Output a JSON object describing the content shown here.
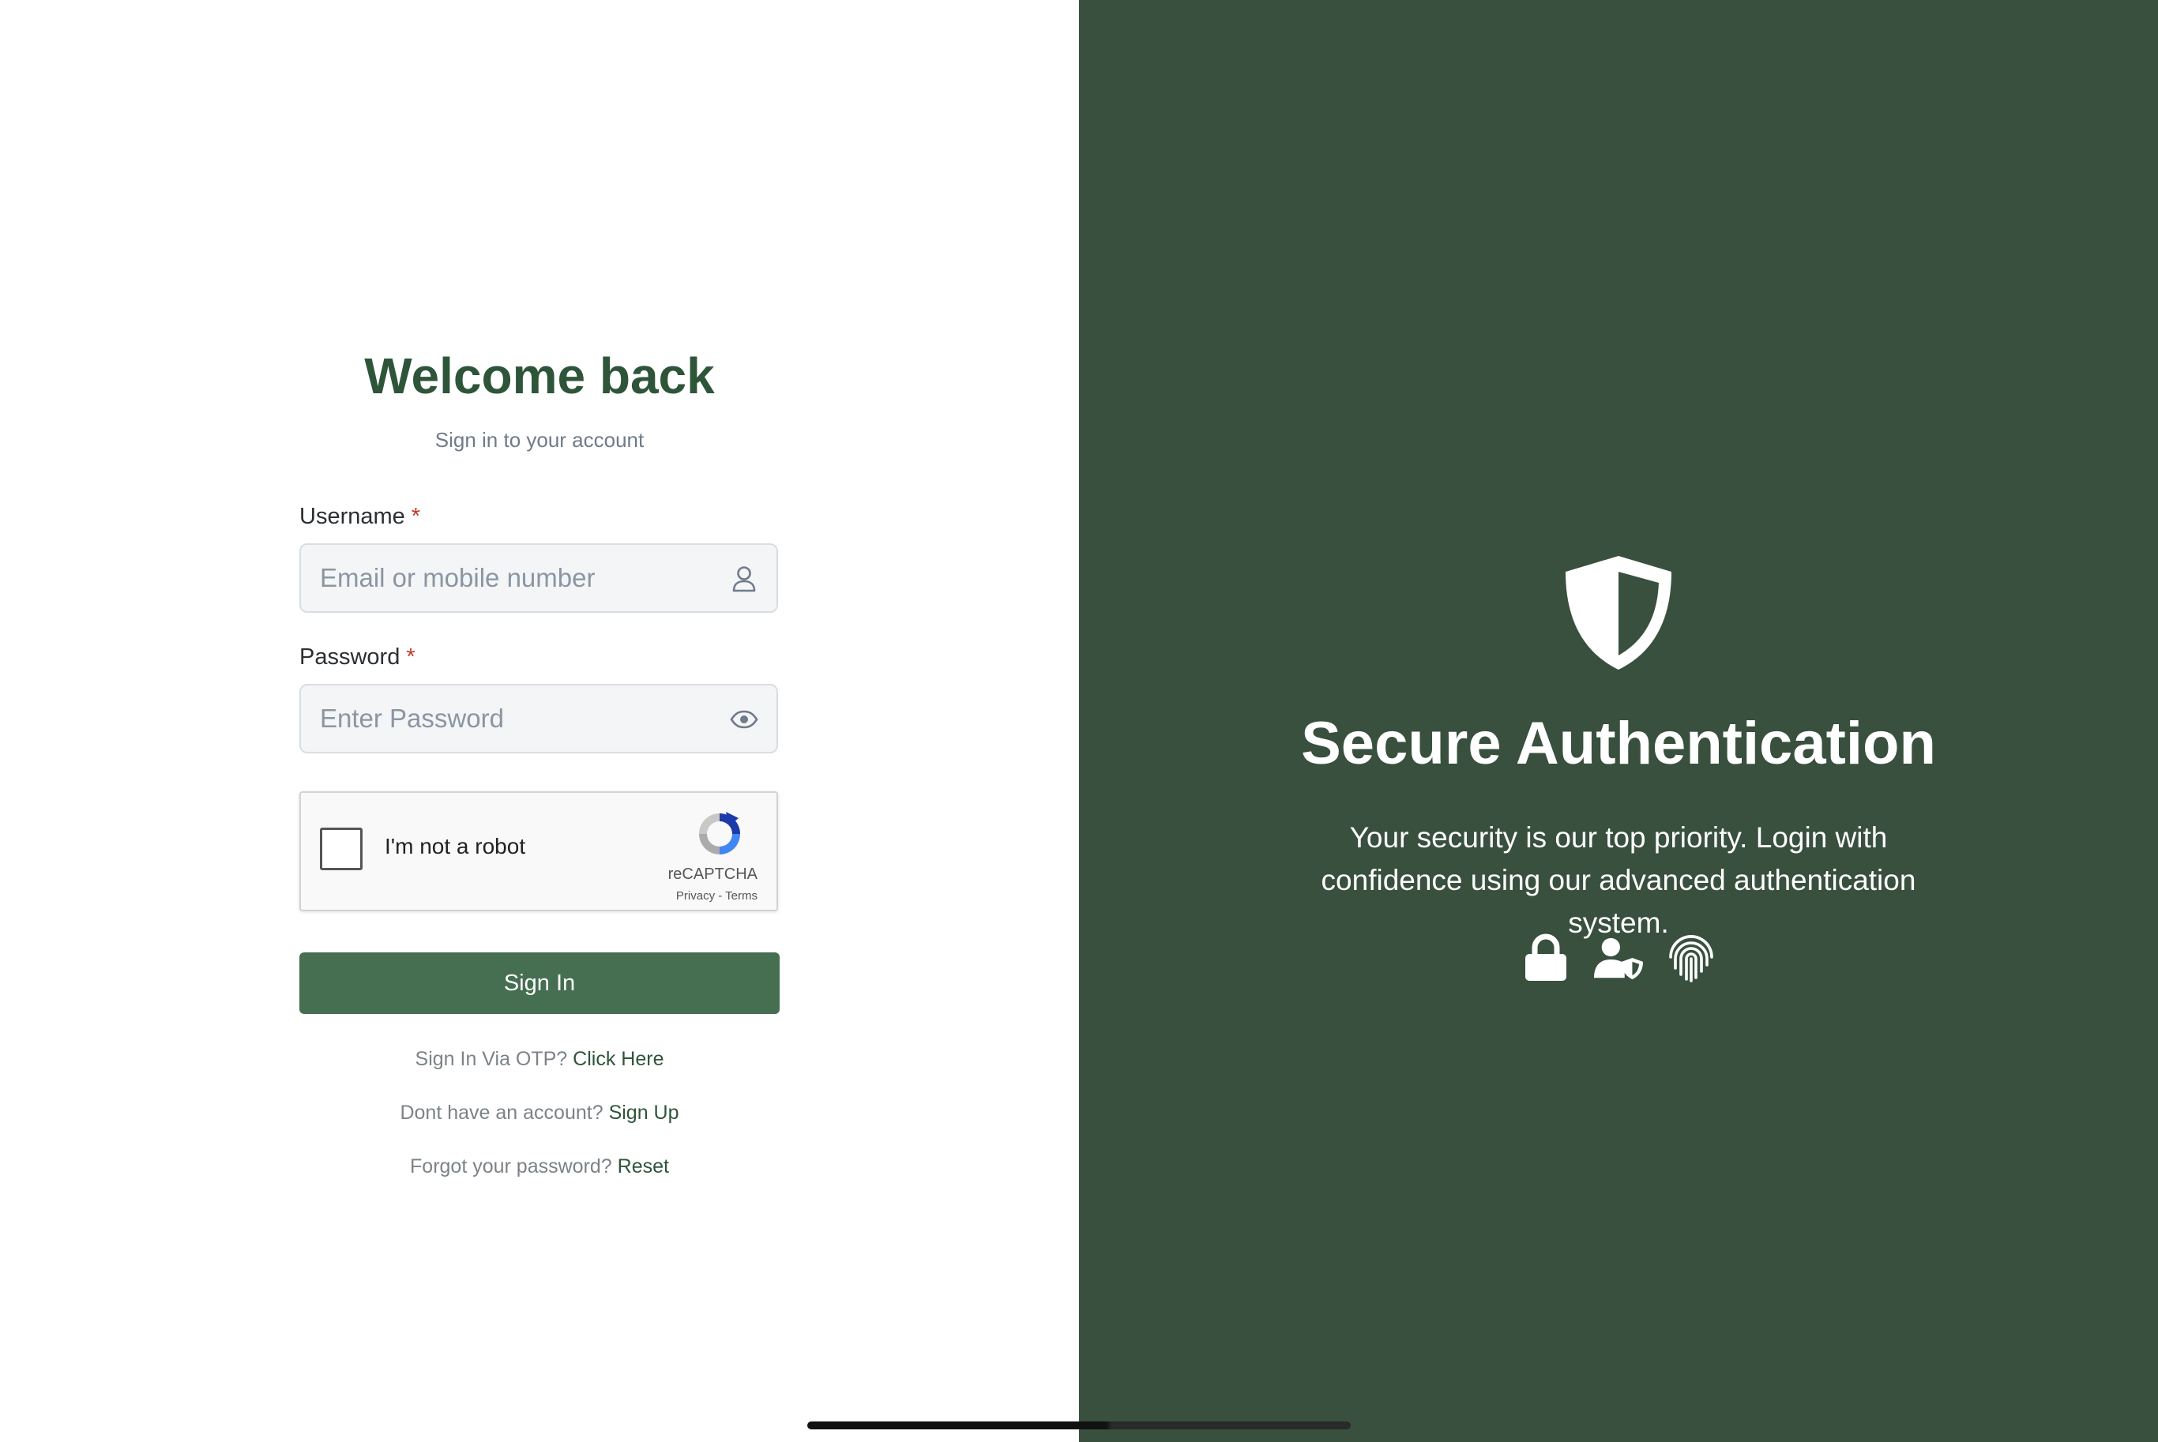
{
  "login": {
    "title": "Welcome back",
    "subtitle": "Sign in to your account",
    "username": {
      "label": "Username",
      "required_mark": "*",
      "placeholder": "Email or mobile number",
      "value": "",
      "icon": "user-icon"
    },
    "password": {
      "label": "Password",
      "required_mark": "*",
      "placeholder": "Enter Password",
      "value": "",
      "icon": "eye-icon"
    },
    "recaptcha": {
      "checkbox_label": "I'm not a robot",
      "brand": "reCAPTCHA",
      "links": "Privacy - Terms",
      "checked": false
    },
    "sign_in_button": "Sign In",
    "otp": {
      "prompt": "Sign In Via OTP?",
      "link": "Click Here"
    },
    "signup": {
      "prompt": "Dont have an account?",
      "link": "Sign Up"
    },
    "forgot": {
      "prompt": "Forgot your password?",
      "link": "Reset"
    }
  },
  "promo": {
    "icon": "shield-icon",
    "title": "Secure Authentication",
    "description": "Your security is our top priority. Login with confidence using our advanced authentication system.",
    "feature_icons": [
      "lock-icon",
      "user-shield-icon",
      "fingerprint-icon"
    ]
  },
  "colors": {
    "brand_green": "#2e5539",
    "panel_green": "#38503d",
    "button_green": "#466e51",
    "required_red": "#c0392b"
  }
}
